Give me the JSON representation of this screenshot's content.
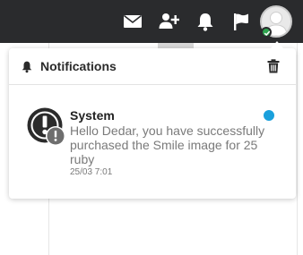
{
  "topbar": {
    "icons": [
      "envelope-icon",
      "add-user-icon",
      "bell-icon",
      "flag-icon",
      "user-avatar"
    ],
    "background": "#2a2b2d",
    "online_status_color": "#2ea44f"
  },
  "notifications_panel": {
    "title": "Notifications",
    "header_icon": "bell-icon",
    "clear_icon": "trash-icon",
    "items": [
      {
        "title": "System",
        "message": "Hello Dedar, you have successfully purchased the Smile image for 25 ruby",
        "timestamp": "25/03 7:01",
        "icon": "exclamation-icon",
        "unread": true,
        "unread_color": "#1aa0dc"
      }
    ]
  }
}
